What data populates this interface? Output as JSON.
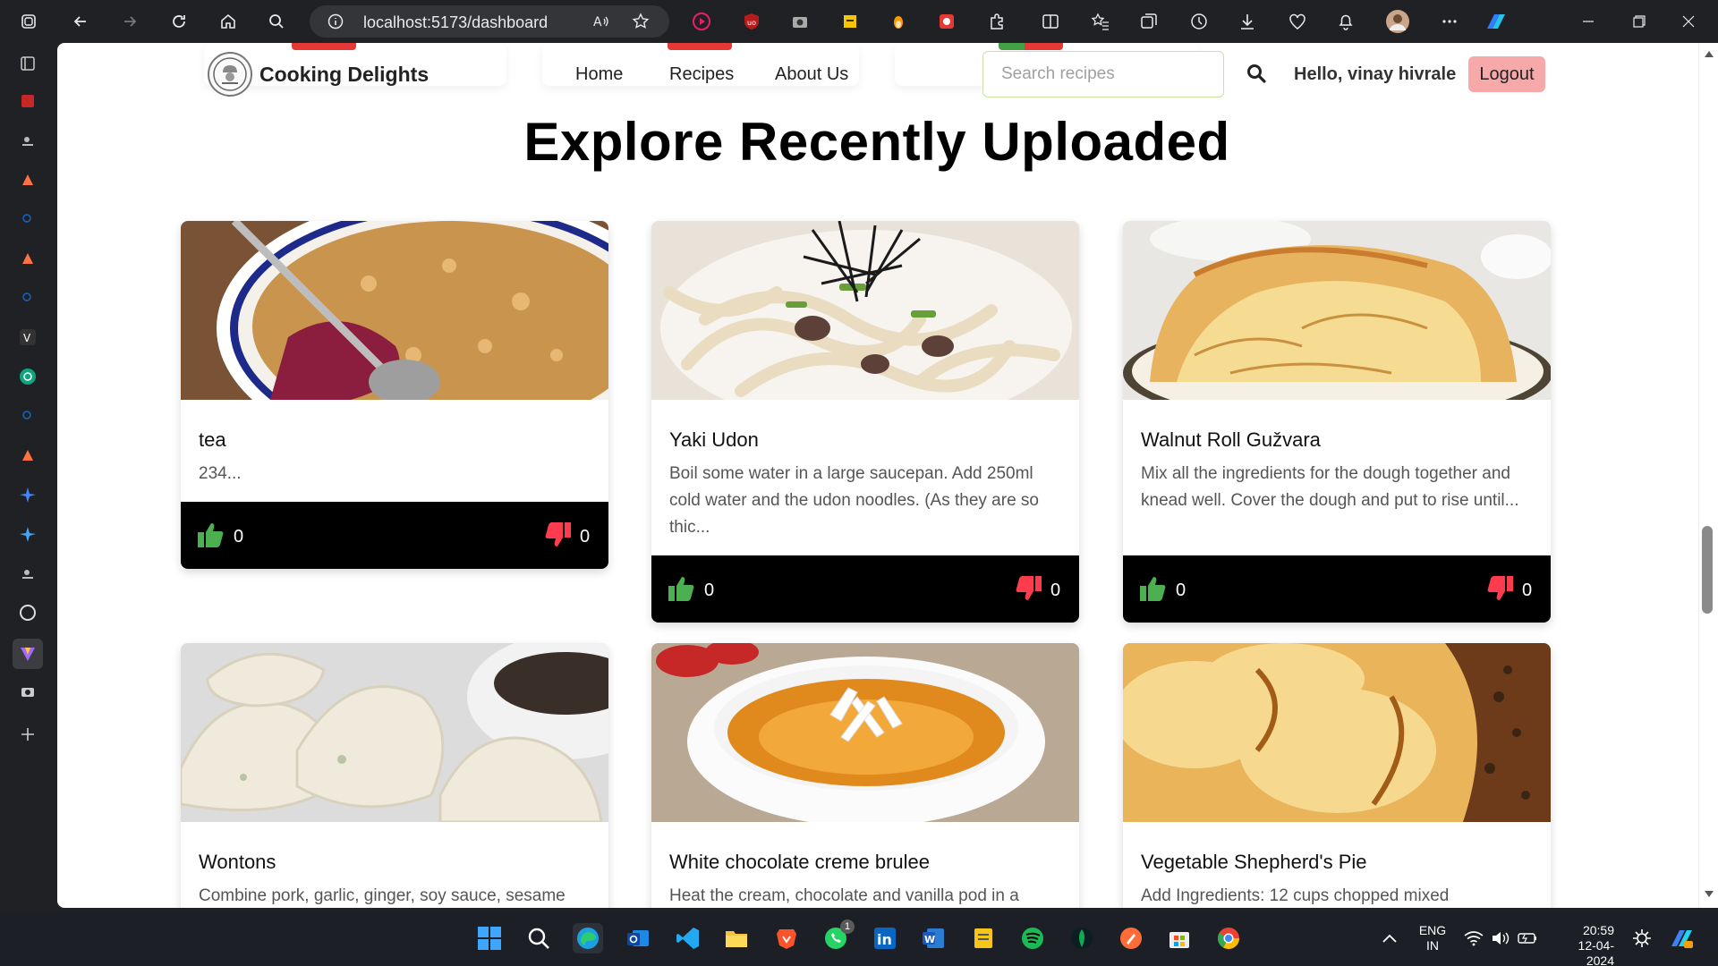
{
  "browser": {
    "url": "localhost:5173/dashboard"
  },
  "navbar": {
    "brand": "Cooking Delights",
    "links": [
      "Home",
      "Recipes",
      "About Us"
    ],
    "search_placeholder": "Search recipes",
    "greeting": "Hello, vinay hivrale",
    "logout": "Logout"
  },
  "heading": "Explore Recently Uploaded",
  "cards": [
    {
      "title": "tea",
      "desc": "234...",
      "likes": "0",
      "dislikes": "0",
      "image": "fruit-crumble-photo"
    },
    {
      "title": "Yaki Udon",
      "desc": "Boil some water in a large saucepan. Add 250ml cold water and the udon noodles. (As they are so thic...",
      "likes": "0",
      "dislikes": "0",
      "image": "udon-noodles-photo"
    },
    {
      "title": "Walnut Roll Gužvara",
      "desc": "Mix all the ingredients for the dough together and knead well. Cover the dough and put to rise until...",
      "likes": "0",
      "dislikes": "0",
      "image": "walnut-roll-pastry-photo"
    },
    {
      "title": "Wontons",
      "desc": "Combine pork, garlic, ginger, soy sauce, sesame",
      "image": "wontons-photo"
    },
    {
      "title": "White chocolate creme brulee",
      "desc": "Heat the cream, chocolate and vanilla pod in a",
      "image": "creme-brulee-photo"
    },
    {
      "title": "Vegetable Shepherd's Pie",
      "desc": "Add Ingredients: 12 cups chopped mixed",
      "image": "shepherds-pie-photo"
    }
  ],
  "colors": {
    "like": "#4caf50",
    "dislike": "#ff3b4e",
    "logout_bg": "#f7a9a9",
    "accent_red": "#e53935"
  },
  "taskbar": {
    "whatsapp_badge": "1",
    "lang_line1": "ENG",
    "lang_line2": "IN",
    "time": "20:59",
    "date": "12-04-2024"
  }
}
